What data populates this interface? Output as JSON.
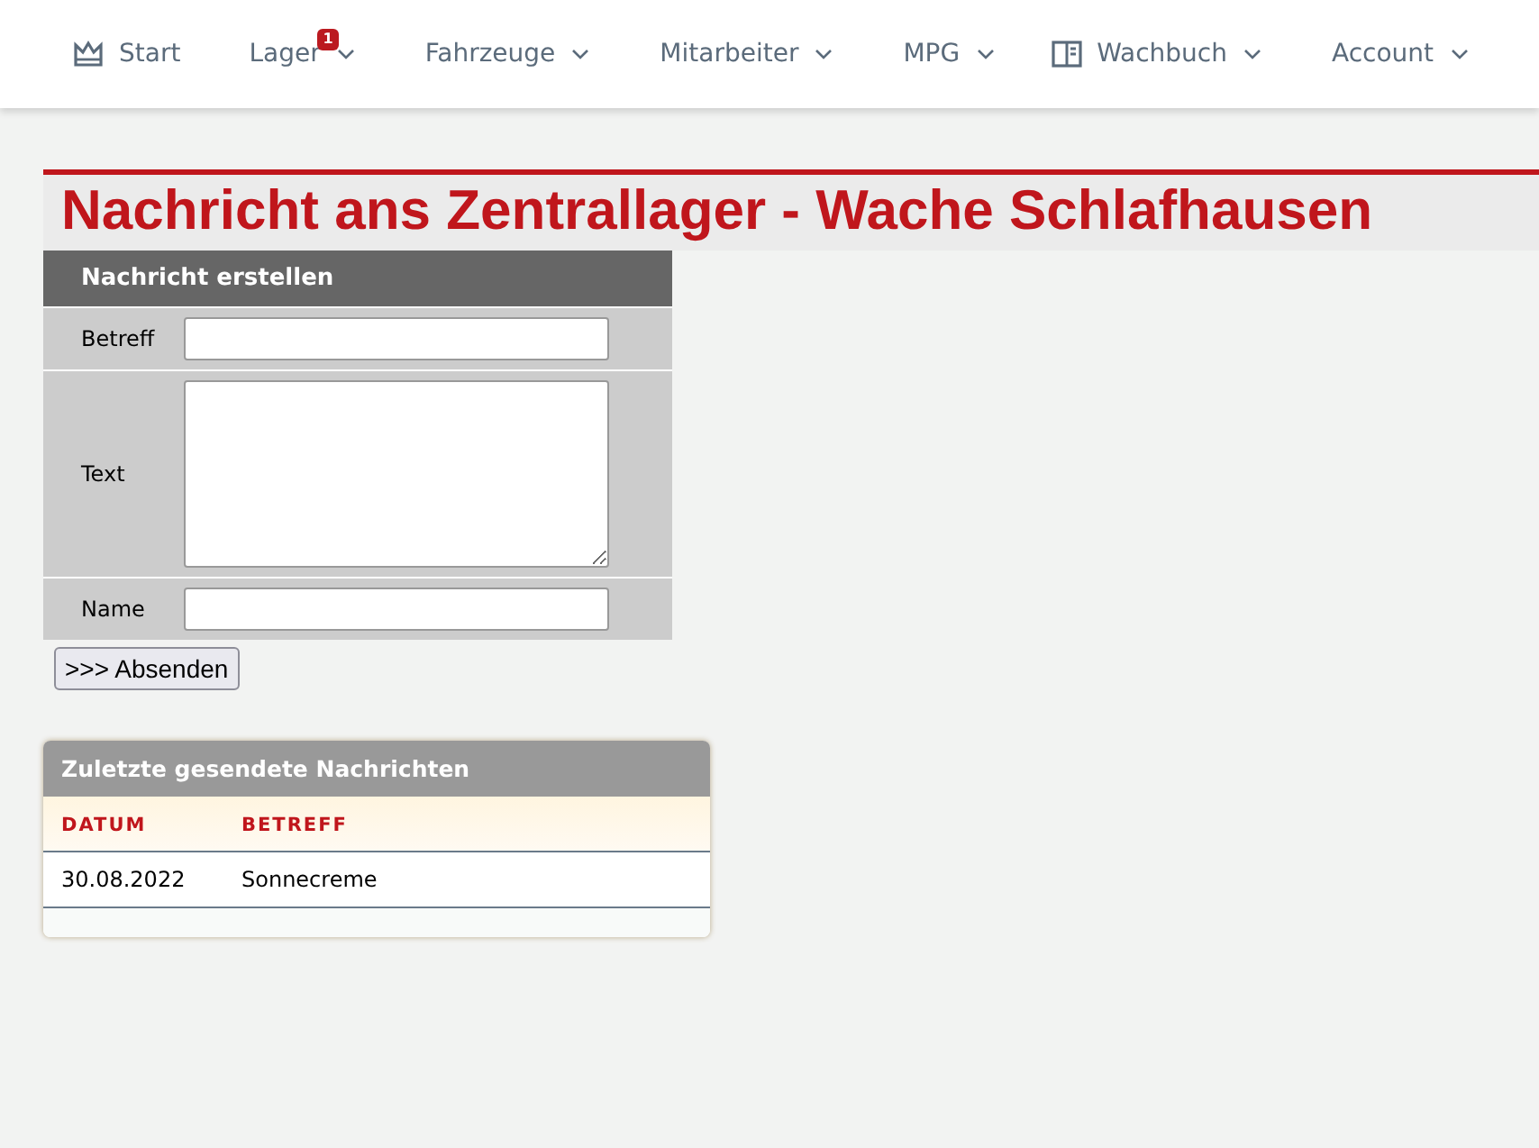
{
  "nav": [
    {
      "label": "Start",
      "kind": "iconed",
      "dropdown": false
    },
    {
      "label": "Lager",
      "kind": "plain",
      "dropdown": true,
      "badge": "1"
    },
    {
      "label": "Fahrzeuge",
      "kind": "plain",
      "dropdown": true
    },
    {
      "label": "Mitarbeiter",
      "kind": "plain",
      "dropdown": true
    },
    {
      "label": "MPG",
      "kind": "plain",
      "dropdown": true
    },
    {
      "label": "Wachbuch",
      "kind": "iconed",
      "dropdown": true
    },
    {
      "label": "Account",
      "kind": "plain",
      "dropdown": true
    }
  ],
  "page_title": "Nachricht ans Zentrallager - Wache Schlafhausen",
  "form": {
    "title": "Nachricht erstellen",
    "fields": [
      {
        "label": "Betreff",
        "kind": "input"
      },
      {
        "label": "Text",
        "kind": "textarea"
      },
      {
        "label": "Name",
        "kind": "input"
      }
    ],
    "submit": ">>> Absenden"
  },
  "recent": {
    "title": "Zuletzte gesendete Nachrichten",
    "columns": [
      "DATUM",
      "BETREFF"
    ],
    "rows": [
      [
        "30.08.2022",
        "Sonnecreme"
      ]
    ]
  }
}
